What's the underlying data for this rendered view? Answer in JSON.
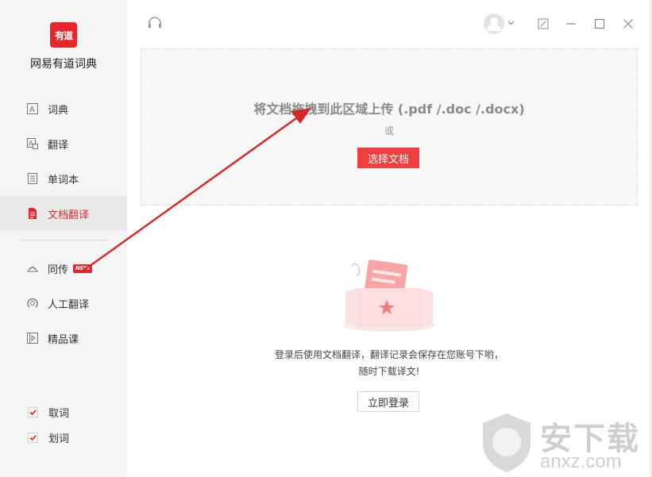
{
  "app": {
    "logo_text": "有道",
    "name": "网易有道词典"
  },
  "sidebar": {
    "items": [
      {
        "label": "词典",
        "icon": "dictionary-icon",
        "active": false
      },
      {
        "label": "翻译",
        "icon": "translate-icon",
        "active": false
      },
      {
        "label": "单词本",
        "icon": "wordbook-icon",
        "active": false
      },
      {
        "label": "文档翻译",
        "icon": "document-icon",
        "active": true
      }
    ],
    "items2": [
      {
        "label": "同传",
        "icon": "interpret-icon",
        "badge": "NEW"
      },
      {
        "label": "人工翻译",
        "icon": "human-translate-icon"
      },
      {
        "label": "精品课",
        "icon": "course-icon"
      }
    ],
    "checks": [
      {
        "label": "取词",
        "checked": true
      },
      {
        "label": "划词",
        "checked": true
      }
    ]
  },
  "dropzone": {
    "title": "将文档拖拽到此区域上传 (.pdf /.doc /.docx)",
    "or": "或",
    "choose_button": "选择文档"
  },
  "empty": {
    "line1": "登录后使用文档翻译，翻译记录会保存在您账号下哟，",
    "line2": "随时下载译文!",
    "login_button": "立即登录"
  },
  "watermark": {
    "text": "安下载",
    "domain": "anxz.com"
  },
  "colors": {
    "accent": "#e8252b",
    "sidebar_bg": "#f5f5f5",
    "dropzone_bg": "#f7f7f7"
  }
}
